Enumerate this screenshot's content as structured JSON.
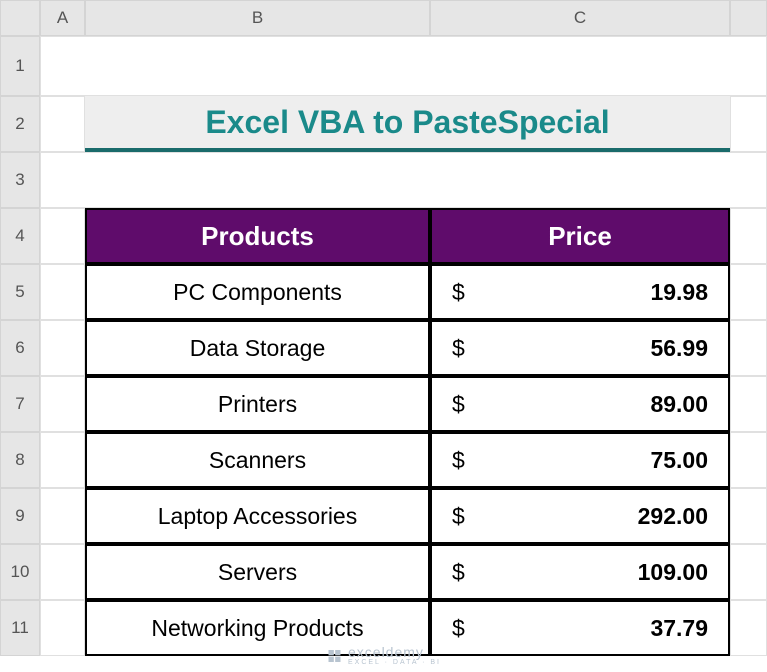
{
  "columns": [
    "A",
    "B",
    "C"
  ],
  "rows": [
    "1",
    "2",
    "3",
    "4",
    "5",
    "6",
    "7",
    "8",
    "9",
    "10",
    "11"
  ],
  "title": "Excel VBA to PasteSpecial",
  "headers": {
    "product": "Products",
    "price": "Price"
  },
  "currency": "$",
  "items": [
    {
      "product": "PC Components",
      "price": "19.98"
    },
    {
      "product": "Data Storage",
      "price": "56.99"
    },
    {
      "product": "Printers",
      "price": "89.00"
    },
    {
      "product": "Scanners",
      "price": "75.00"
    },
    {
      "product": "Laptop Accessories",
      "price": "292.00"
    },
    {
      "product": "Servers",
      "price": "109.00"
    },
    {
      "product": "Networking Products",
      "price": "37.79"
    }
  ],
  "watermark": {
    "main": "exceldemy",
    "sub": "EXCEL · DATA · BI"
  },
  "chart_data": {
    "type": "table",
    "title": "Excel VBA to PasteSpecial",
    "columns": [
      "Products",
      "Price"
    ],
    "rows": [
      [
        "PC Components",
        19.98
      ],
      [
        "Data Storage",
        56.99
      ],
      [
        "Printers",
        89.0
      ],
      [
        "Scanners",
        75.0
      ],
      [
        "Laptop Accessories",
        292.0
      ],
      [
        "Servers",
        109.0
      ],
      [
        "Networking Products",
        37.79
      ]
    ]
  }
}
